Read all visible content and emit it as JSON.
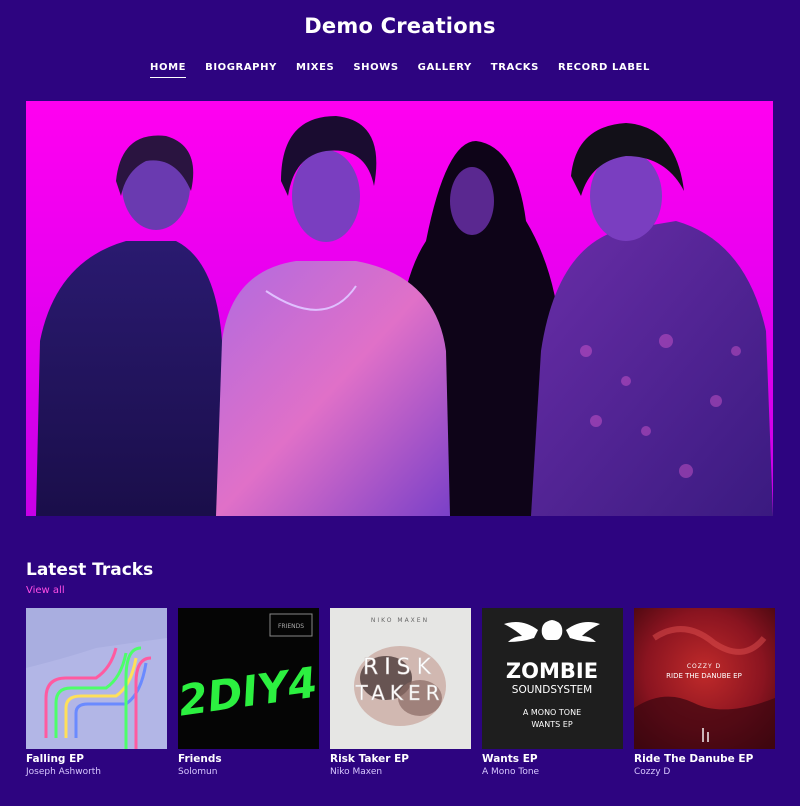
{
  "site": {
    "title": "Demo Creations"
  },
  "nav": {
    "items": [
      {
        "label": "HOME",
        "active": true
      },
      {
        "label": "BIOGRAPHY"
      },
      {
        "label": "MIXES"
      },
      {
        "label": "SHOWS"
      },
      {
        "label": "GALLERY"
      },
      {
        "label": "TRACKS"
      },
      {
        "label": "RECORD LABEL"
      }
    ]
  },
  "hero": {
    "image": "band-photo"
  },
  "latest": {
    "title": "Latest Tracks",
    "view_all": "View all",
    "tracks": [
      {
        "title": "Falling EP",
        "artist": "Joseph Ashworth",
        "cover": "falling-ep-cover"
      },
      {
        "title": "Friends",
        "artist": "Solomun",
        "cover": "friends-cover",
        "cover_text": {
          "big": "2DIY4",
          "tag": "FRIENDS"
        }
      },
      {
        "title": "Risk Taker EP",
        "artist": "Niko Maxen",
        "cover": "risk-taker-cover",
        "cover_text": {
          "top": "NIKO MAXEN",
          "line1": "RISK",
          "line2": "TAKER"
        }
      },
      {
        "title": "Wants EP",
        "artist": "A Mono Tone",
        "cover": "wants-ep-cover",
        "cover_text": {
          "line1": "ZOMBIE",
          "line2": "SOUNDSYSTEM",
          "line3": "A MONO TONE",
          "line4": "WANTS EP"
        }
      },
      {
        "title": "Ride The Danube EP",
        "artist": "Cozzy D",
        "cover": "ride-the-danube-cover",
        "cover_text": {
          "line1": "COZZY D",
          "line2": "RIDE THE DANUBE EP"
        }
      }
    ]
  },
  "colors": {
    "background": "#2d0480",
    "accent": "#ff4ee6",
    "hero_pink": "#ff00f0"
  }
}
